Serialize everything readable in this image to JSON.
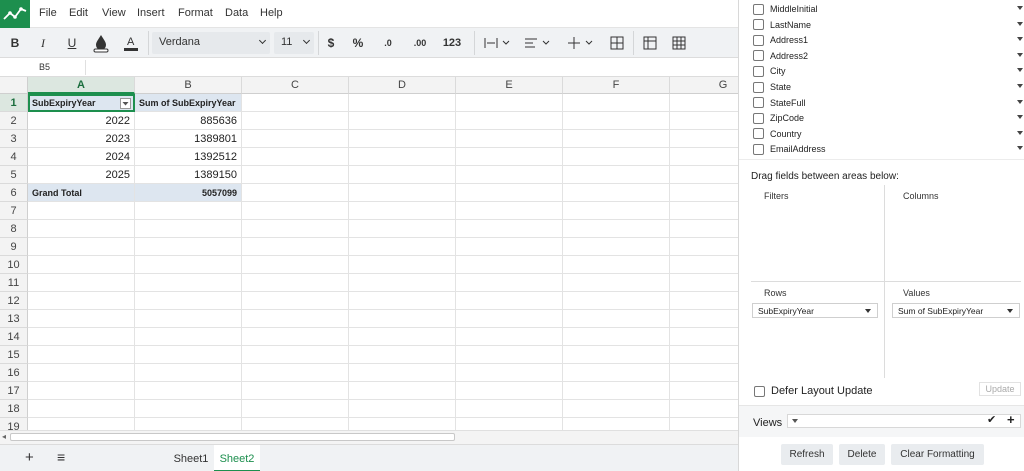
{
  "menu": [
    "File",
    "Edit",
    "View",
    "Insert",
    "Format",
    "Data",
    "Help"
  ],
  "toolbar": {
    "bold": "B",
    "italic": "I",
    "underline": "U",
    "font_family": "Verdana",
    "font_size": "11",
    "currency": "$",
    "percent": "%",
    "decrease_decimals": ".0",
    "increase_decimals": ".00",
    "number_format": "123"
  },
  "name_box": "B5",
  "columns": [
    "A",
    "B",
    "C",
    "D",
    "E",
    "F",
    "G"
  ],
  "rows": [
    "1",
    "2",
    "3",
    "4",
    "5",
    "6",
    "7",
    "8",
    "9",
    "10",
    "11",
    "12",
    "13",
    "14",
    "15",
    "16",
    "17",
    "18",
    "19"
  ],
  "pivot": {
    "header_a": "SubExpiryYear",
    "header_b": "Sum of SubExpiryYear",
    "data": [
      {
        "year": "2022",
        "sum": "885636"
      },
      {
        "year": "2023",
        "sum": "1389801"
      },
      {
        "year": "2024",
        "sum": "1392512"
      },
      {
        "year": "2025",
        "sum": "1389150"
      }
    ],
    "grand_total_label": "Grand Total",
    "grand_total_value": "5057099"
  },
  "sheets": [
    "Sheet1",
    "Sheet2"
  ],
  "active_sheet": "Sheet2",
  "panel": {
    "fields": [
      "MiddleInitial",
      "LastName",
      "Address1",
      "Address2",
      "City",
      "State",
      "StateFull",
      "ZipCode",
      "Country",
      "EmailAddress"
    ],
    "drag_hint": "Drag fields between areas below:",
    "filters_title": "Filters",
    "columns_title": "Columns",
    "rows_title": "Rows",
    "values_title": "Values",
    "rows_field": "SubExpiryYear",
    "values_field": "Sum of SubExpiryYear",
    "defer_label": "Defer Layout Update",
    "update_label": "Update",
    "views_label": "Views",
    "refresh_label": "Refresh",
    "delete_label": "Delete",
    "clear_label": "Clear Formatting"
  },
  "colors": {
    "accent": "#1d8f4e",
    "pivot_header_bg": "#dde6f0"
  }
}
